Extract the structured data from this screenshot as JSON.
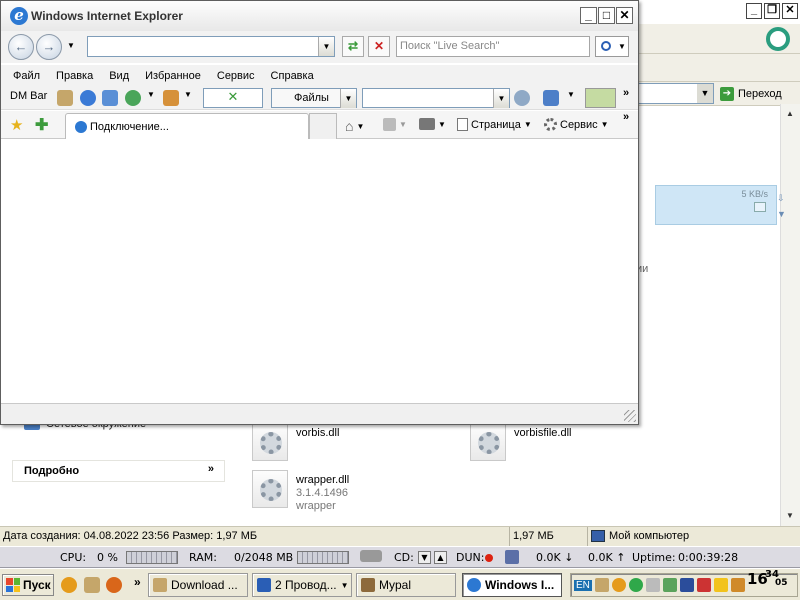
{
  "explorer": {
    "go_label": "Переход",
    "download_speed": "5 KB/s",
    "cut_text": "ии",
    "left_panel_item": "Сетевое окружение",
    "details_title": "Подробно",
    "files": [
      {
        "name": "vorbis.dll",
        "version": "",
        "description": ""
      },
      {
        "name": "vorbisfile.dll",
        "version": "",
        "description": ""
      },
      {
        "name": "wrapper.dll",
        "version": "3.1.4.1496",
        "description": "wrapper"
      }
    ],
    "status": {
      "info": "Дата создания: 04.08.2022 23:56 Размер: 1,97 МБ",
      "size": "1,97 МБ",
      "location": "Мой компьютер"
    }
  },
  "monitor": {
    "cpu_label": "CPU:",
    "cpu_value": "0 %",
    "ram_label": "RAM:",
    "ram_value": "0/2048 MB",
    "cd_label": "CD:",
    "dun_label": "DUN:",
    "down": "0.0K",
    "up": "0.0K",
    "uptime_label": "Uptime:",
    "uptime_value": "0:00:39:28"
  },
  "taskbar": {
    "start_label": "Пуск",
    "more": "»",
    "buttons": [
      {
        "label": "Download ..."
      },
      {
        "label": "2 Провод..."
      },
      {
        "label": "Mypal"
      },
      {
        "label": "Windows I..."
      }
    ],
    "lang": "EN",
    "clock_hour": "16",
    "clock_min": "34",
    "clock_sec": "05"
  },
  "ie": {
    "title": "Windows Internet Explorer",
    "address_value": "",
    "search_placeholder": "Поиск \"Live Search\"",
    "menu": [
      "Файл",
      "Правка",
      "Вид",
      "Избранное",
      "Сервис",
      "Справка"
    ],
    "dm_bar": "DM Bar",
    "files_dropdown": "Файлы",
    "more": "»",
    "tab_label": "Подключение...",
    "page_label": "Страница",
    "service_label": "Сервис"
  }
}
